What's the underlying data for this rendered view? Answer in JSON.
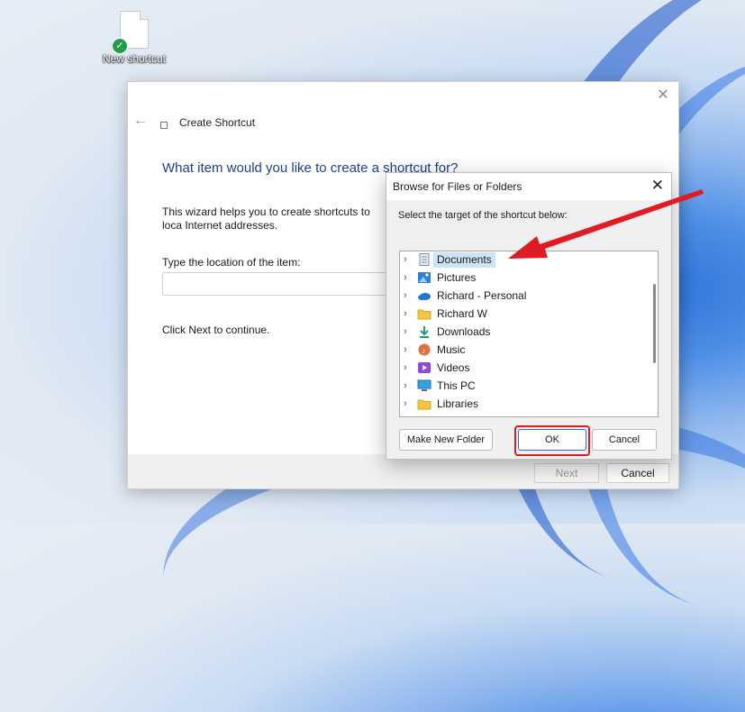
{
  "desktop": {
    "icon_label": "New shortcut"
  },
  "wizard": {
    "title": "Create Shortcut",
    "heading": "What item would you like to create a shortcut for?",
    "description": "This wizard helps you to create shortcuts to loca Internet addresses.",
    "location_label": "Type the location of the item:",
    "location_value": "",
    "continue_text": "Click Next to continue.",
    "next_label": "Next",
    "cancel_label": "Cancel"
  },
  "browse": {
    "title": "Browse for Files or Folders",
    "subtitle": "Select the target of the shortcut below:",
    "items": [
      {
        "label": "Documents",
        "icon": "documents-icon",
        "selected": true
      },
      {
        "label": "Pictures",
        "icon": "pictures-icon"
      },
      {
        "label": "Richard - Personal",
        "icon": "onedrive-icon"
      },
      {
        "label": "Richard W",
        "icon": "user-folder-icon"
      },
      {
        "label": "Downloads",
        "icon": "downloads-icon"
      },
      {
        "label": "Music",
        "icon": "music-icon"
      },
      {
        "label": "Videos",
        "icon": "videos-icon"
      },
      {
        "label": "This PC",
        "icon": "this-pc-icon"
      },
      {
        "label": "Libraries",
        "icon": "libraries-icon"
      }
    ],
    "new_folder_label": "Make New Folder",
    "ok_label": "OK",
    "cancel_label": "Cancel"
  },
  "colors": {
    "accent": "#2a6fd6",
    "annotation": "#e01b24",
    "selection": "#cce4f7"
  }
}
